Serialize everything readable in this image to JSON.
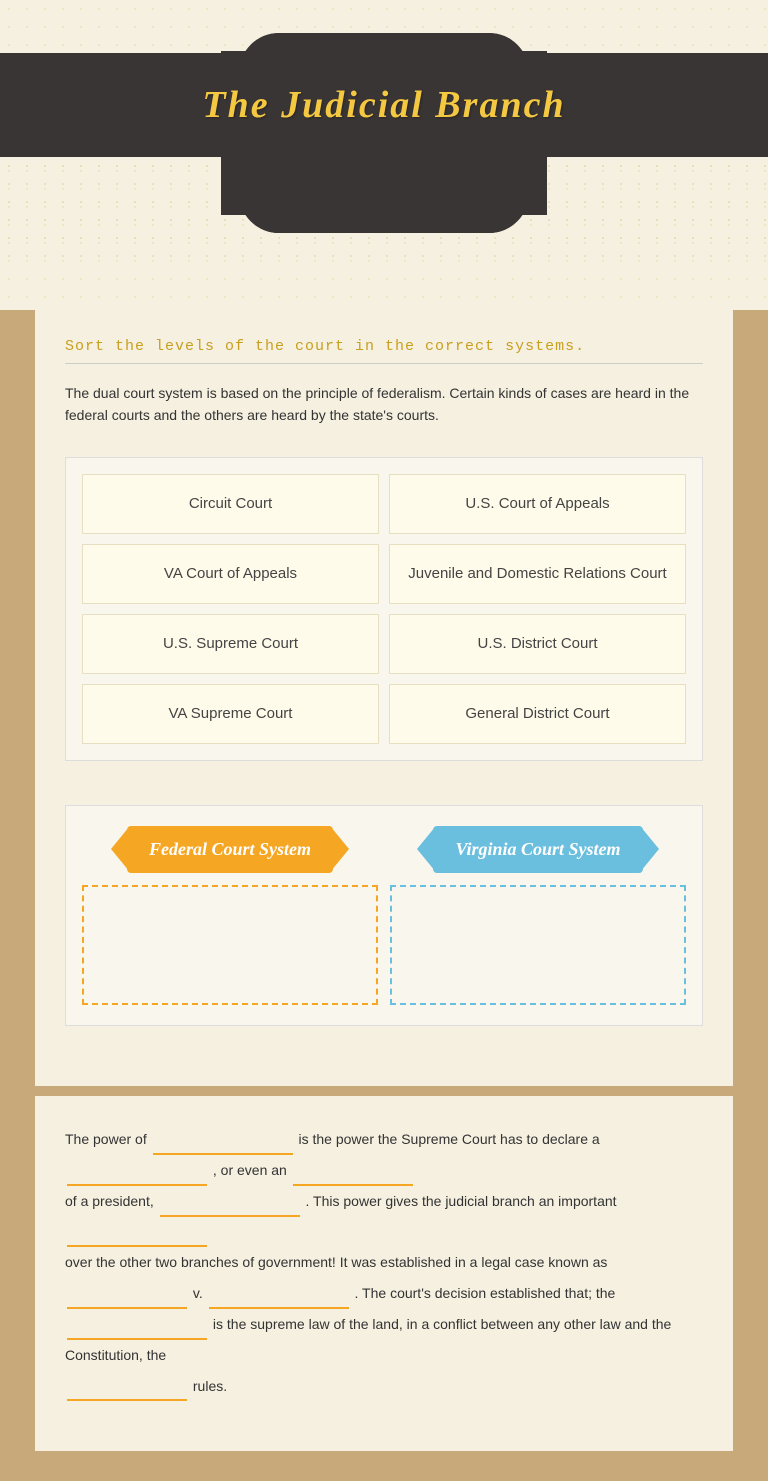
{
  "header": {
    "title": "The Judicial Branch"
  },
  "instruction": {
    "text": "Sort the levels of the court in the correct systems."
  },
  "description": {
    "text": "The dual court system is based on the principle of federalism.  Certain kinds of cases are heard in the federal courts and the others are heard by the state's courts."
  },
  "cards": [
    {
      "id": "circuit-court",
      "label": "Circuit Court"
    },
    {
      "id": "us-court-of-appeals",
      "label": "U.S. Court of Appeals"
    },
    {
      "id": "va-court-of-appeals",
      "label": "VA Court of Appeals"
    },
    {
      "id": "juvenile-domestic",
      "label": "Juvenile and Domestic Relations Court"
    },
    {
      "id": "us-supreme-court",
      "label": "U.S. Supreme Court"
    },
    {
      "id": "us-district-court",
      "label": "U.S. District Court"
    },
    {
      "id": "va-supreme-court",
      "label": "VA Supreme Court"
    },
    {
      "id": "general-district-court",
      "label": "General District Court"
    }
  ],
  "drop_zones": {
    "federal": {
      "label": "Federal Court System"
    },
    "virginia": {
      "label": "Virginia Court System"
    }
  },
  "fill_blank": {
    "prefix1": "The power of",
    "suffix1": "is the power the Supreme Court has to declare a",
    "suffix2": ", or even an",
    "suffix3": "of a president,",
    "suffix4": ". This power gives the judicial branch an important",
    "suffix5": "over the other two branches of government! It was established in a legal case known as",
    "suffix6": "v.",
    "suffix7": ". The court's decision established that; the",
    "suffix8": "is the supreme law of the land, in a conflict between any other law and the Constitution, the",
    "suffix9": "rules."
  }
}
